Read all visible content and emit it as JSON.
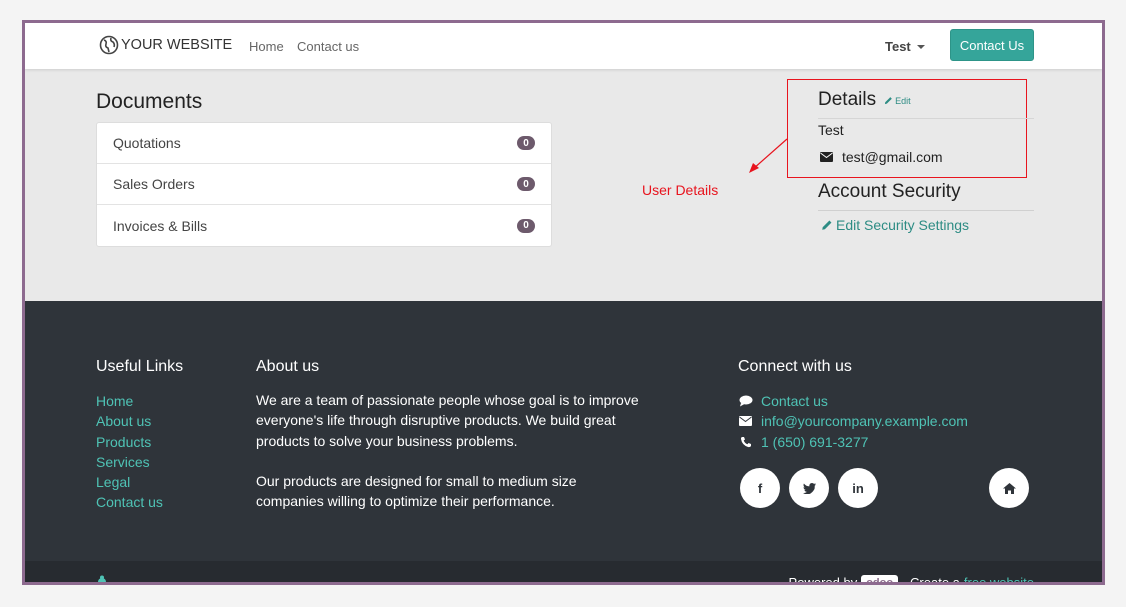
{
  "header": {
    "logo_text": "YOUR WEBSITE",
    "nav": [
      "Home",
      "Contact us"
    ],
    "user_name": "Test",
    "contact_button": "Contact Us"
  },
  "documents": {
    "title": "Documents",
    "items": [
      {
        "label": "Quotations",
        "count": "0"
      },
      {
        "label": "Sales Orders",
        "count": "0"
      },
      {
        "label": "Invoices & Bills",
        "count": "0"
      }
    ]
  },
  "annotation": {
    "label": "User Details",
    "color": "#e8141e"
  },
  "details": {
    "title": "Details",
    "edit_label": "Edit",
    "name": "Test",
    "email": "test@gmail.com"
  },
  "security": {
    "title": "Account Security",
    "link_label": "Edit Security Settings"
  },
  "footer": {
    "useful_links_title": "Useful Links",
    "useful_links": [
      "Home",
      "About us",
      "Products",
      "Services",
      "Legal",
      "Contact us"
    ],
    "about_title": "About us",
    "about_p1": "We are a team of passionate people whose goal is to improve everyone's life through disruptive products. We build great products to solve your business problems.",
    "about_p2": "Our products are designed for small to medium size companies willing to optimize their performance.",
    "connect_title": "Connect with us",
    "connect_contact": "Contact us",
    "connect_email": "info@yourcompany.example.com",
    "connect_phone": "1 (650) 691-3277",
    "social": {
      "facebook": "f",
      "twitter": "t",
      "linkedin": "in"
    }
  },
  "copyright": {
    "powered_by": "Powered by",
    "odoo": "odoo",
    "create_text": "- Create a",
    "free_website": "free website"
  },
  "colors": {
    "accent": "#35a59a",
    "link": "#4fc3b5",
    "footer_bg": "#2f343a",
    "badge": "#6d5a6c",
    "frame_border": "#8d6a8f"
  }
}
